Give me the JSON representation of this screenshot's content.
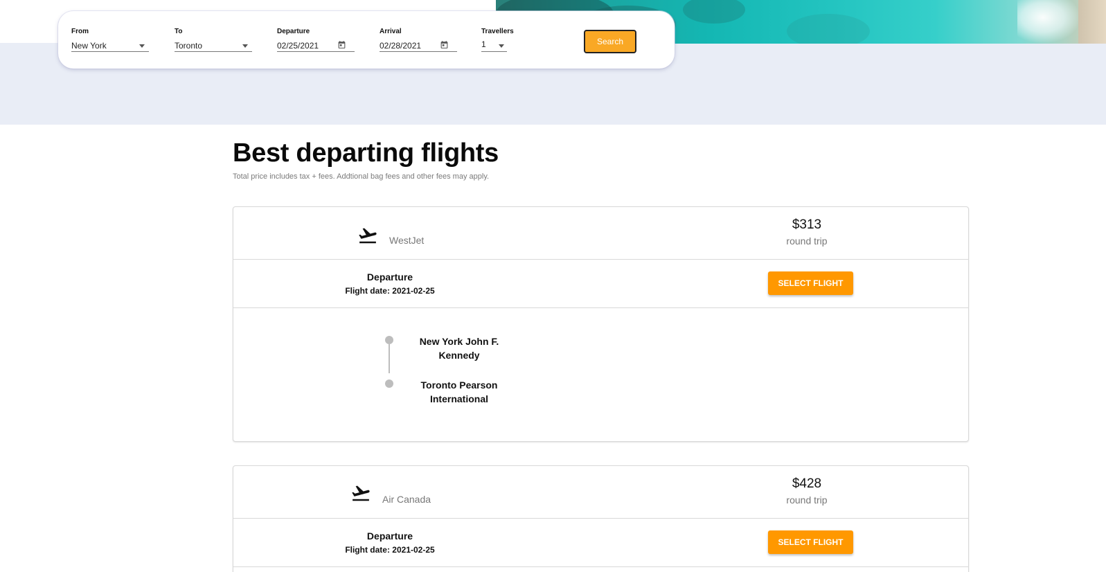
{
  "search": {
    "from_label": "From",
    "from_value": "New York",
    "to_label": "To",
    "to_value": "Toronto",
    "departure_label": "Departure",
    "departure_value": "02/25/2021",
    "arrival_label": "Arrival",
    "arrival_value": "02/28/2021",
    "travellers_label": "Travellers",
    "travellers_value": "1",
    "search_button": "Search"
  },
  "results": {
    "title": "Best departing flights",
    "subtitle": "Total price includes tax + fees. Addtional bag fees and other fees may apply."
  },
  "flights": [
    {
      "airline": "WestJet",
      "price": "$313",
      "trip_type": "round trip",
      "leg_title": "Departure",
      "flight_date": "Flight date: 2021-02-25",
      "select_label": "SELECT FLIGHT",
      "origin": "New York John F. Kennedy",
      "destination": "Toronto Pearson International"
    },
    {
      "airline": "Air Canada",
      "price": "$428",
      "trip_type": "round trip",
      "leg_title": "Departure",
      "flight_date": "Flight date: 2021-02-25",
      "select_label": "SELECT FLIGHT"
    }
  ],
  "icons": {
    "flight": "flight-takeoff-icon",
    "calendar": "calendar-icon",
    "dropdown": "chevron-down-icon"
  },
  "colors": {
    "accent": "#ff9800",
    "search_button": "#f9a825",
    "hero_band": "#e9edf6"
  }
}
